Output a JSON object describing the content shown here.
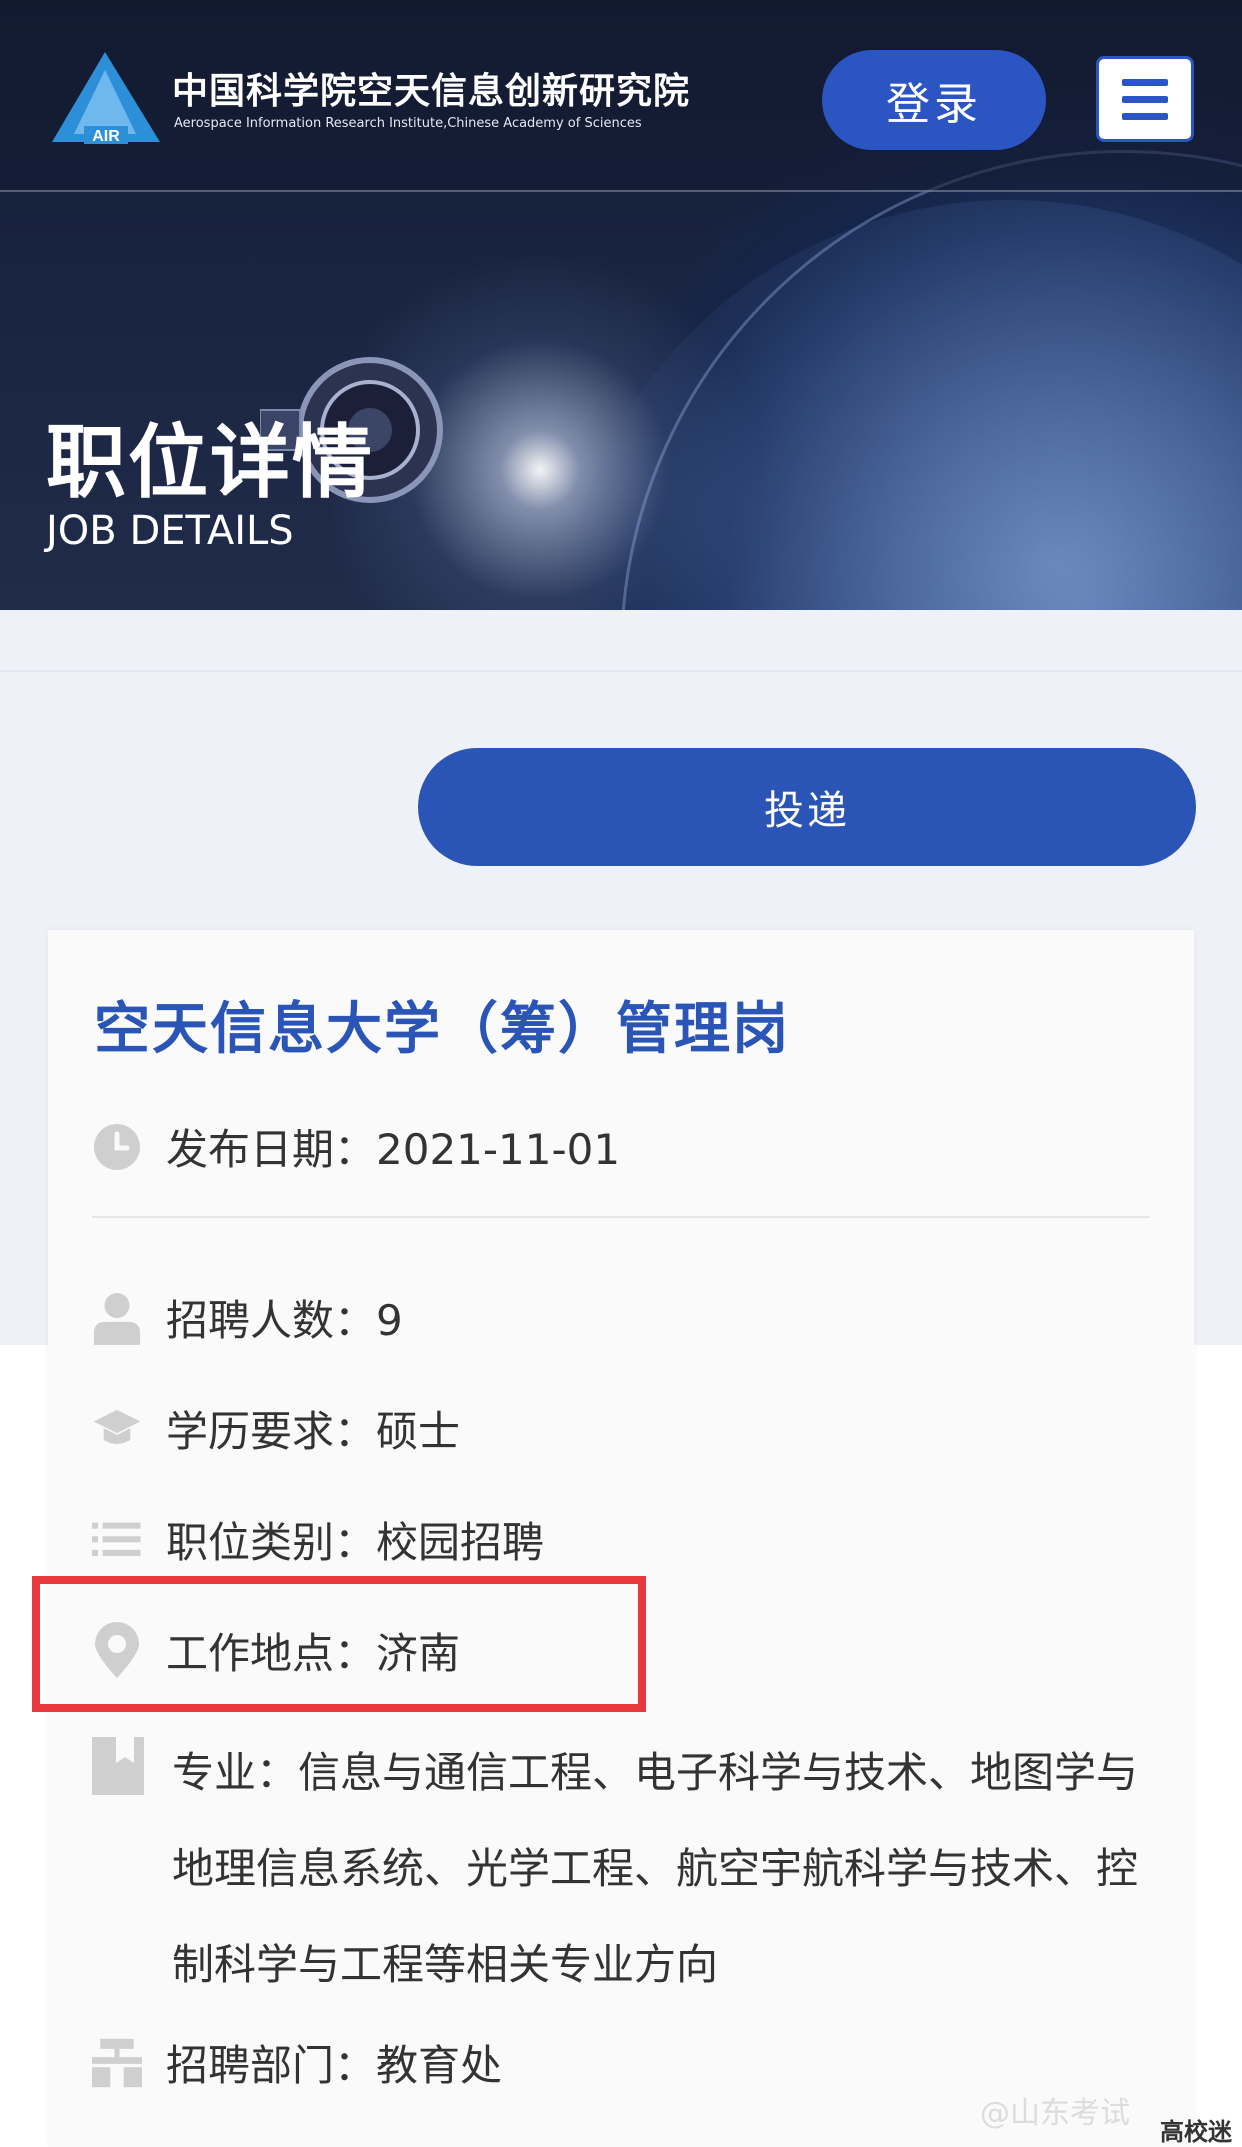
{
  "header": {
    "org_name_cn": "中国科学院空天信息创新研究院",
    "org_name_en": "Aerospace Information Research Institute,Chinese Academy of Sciences",
    "logo_text": "AIR",
    "login_label": "登录",
    "menu_icon": "hamburger-menu-icon"
  },
  "hero": {
    "title": "职位详情",
    "subtitle": "JOB DETAILS"
  },
  "actions": {
    "apply_label": "投递"
  },
  "job": {
    "title": "空天信息大学（筹）管理岗",
    "publish_date": "发布日期：2021-11-01",
    "headcount": "招聘人数：9",
    "education": "学历要求：硕士",
    "category": "职位类别：校园招聘",
    "location": "工作地点：济南",
    "major_label": "专业：",
    "major_lines": [
      "专业：信息与通信工程、电子科学与技术、地图学与",
      "地理信息系统、光学工程、航空宇航科学与技术、控",
      "制科学与工程等相关专业方向"
    ],
    "department": "招聘部门：教育处"
  },
  "icons": {
    "date": "clock-icon",
    "headcount": "person-icon",
    "education": "graduation-cap-icon",
    "category": "list-icon",
    "location": "location-pin-icon",
    "major": "bookmark-icon",
    "department": "org-chart-icon"
  },
  "colors": {
    "brand_blue": "#2a55b6",
    "highlight_red": "#e8393f",
    "band_gray": "#eef1f8"
  },
  "watermark": {
    "text": "@山东考试",
    "brand": "高校迷"
  }
}
